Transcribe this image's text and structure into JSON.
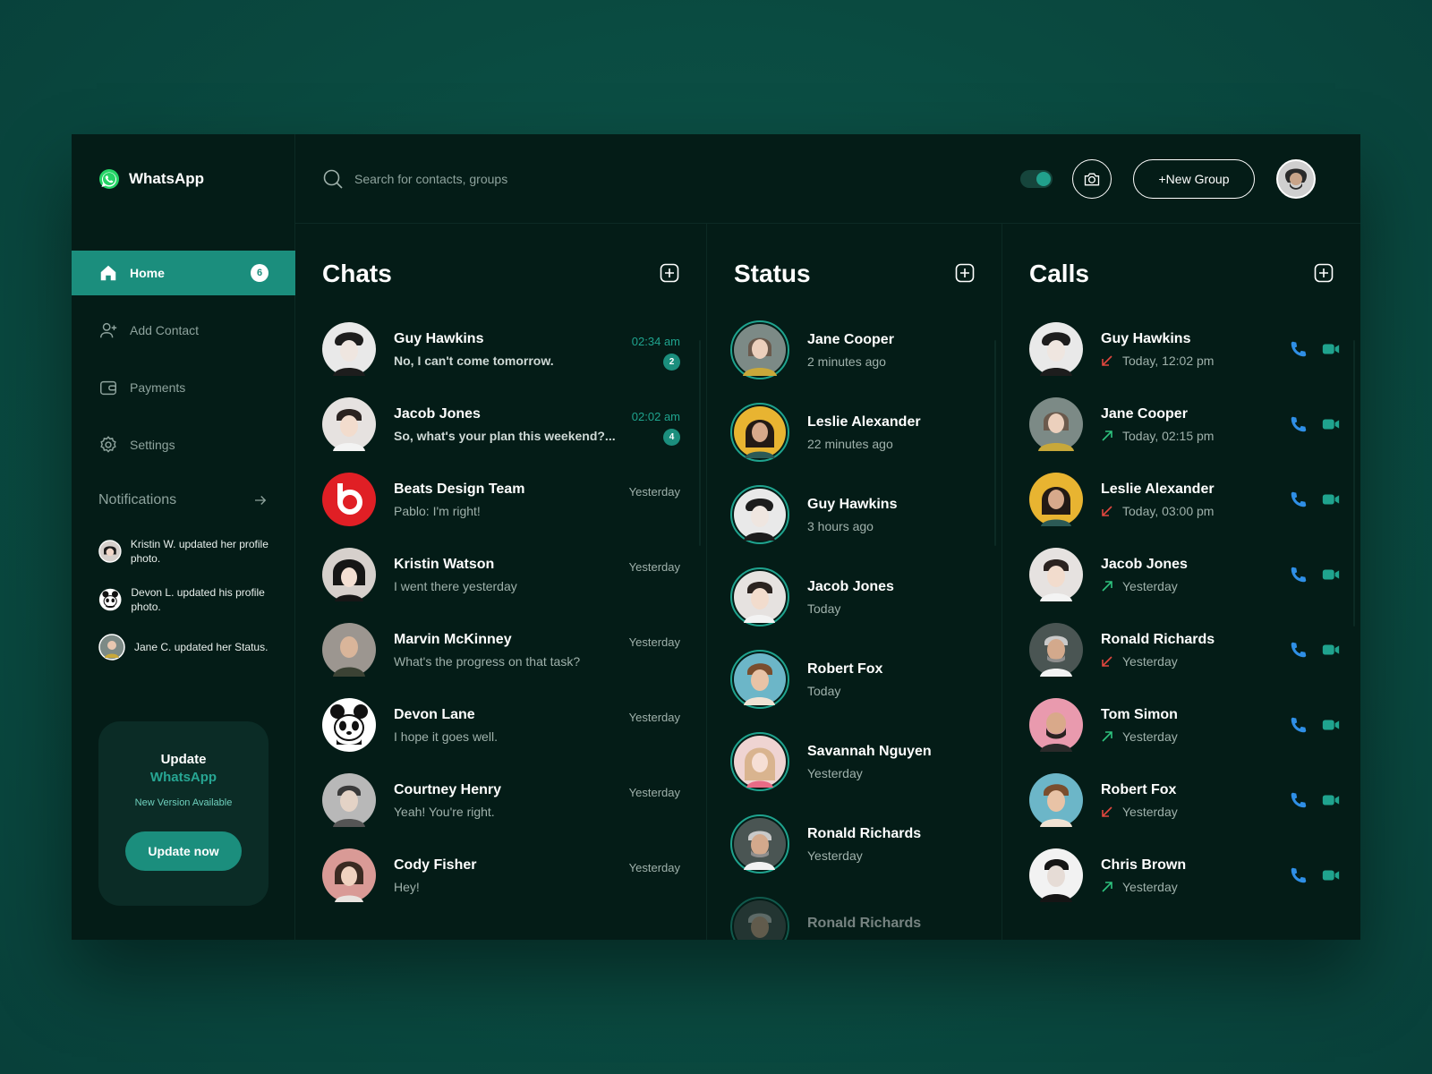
{
  "app": {
    "brand": "WhatsApp"
  },
  "nav": [
    {
      "label": "Home",
      "badge": "6",
      "icon": "home-icon",
      "active": true
    },
    {
      "label": "Add Contact",
      "icon": "add-user-icon"
    },
    {
      "label": "Payments",
      "icon": "wallet-icon"
    },
    {
      "label": "Settings",
      "icon": "gear-icon"
    }
  ],
  "notifications": {
    "title": "Notifications",
    "items": [
      {
        "text": "Kristin W. updated her profile photo.",
        "avatar": "#d6d0cc"
      },
      {
        "text": "Devon L. updated his profile photo.",
        "avatar": "#ffffff"
      },
      {
        "text": "Jane C. updated her Status.",
        "avatar": "#7c8a86"
      }
    ]
  },
  "update_card": {
    "title": "Update",
    "brand": "WhatsApp",
    "subtitle": "New Version Available",
    "button": "Update now"
  },
  "topbar": {
    "search_placeholder": "Search for contacts, groups",
    "new_group_label": "+New Group"
  },
  "chats": {
    "title": "Chats",
    "items": [
      {
        "name": "Guy Hawkins",
        "message": "No, I can't come tomorrow.",
        "time": "02:34 am",
        "unread": "2",
        "avatar": "#e9e9e9"
      },
      {
        "name": "Jacob Jones",
        "message": "So, what's your plan this weekend?...",
        "time": "02:02 am",
        "unread": "4",
        "avatar": "#e6e2e0"
      },
      {
        "name": "Beats Design Team",
        "message": "Pablo: I'm right!",
        "time": "Yesterday",
        "avatar": "#e01f25"
      },
      {
        "name": "Kristin Watson",
        "message": "I went there yesterday",
        "time": "Yesterday",
        "avatar": "#d6d0cc"
      },
      {
        "name": "Marvin McKinney",
        "message": "What's the progress on that task?",
        "time": "Yesterday",
        "avatar": "#9c9690"
      },
      {
        "name": "Devon Lane",
        "message": "I hope it goes well.",
        "time": "Yesterday",
        "avatar": "#ffffff"
      },
      {
        "name": "Courtney Henry",
        "message": "Yeah! You're right.",
        "time": "Yesterday",
        "avatar": "#b8b8b8"
      },
      {
        "name": "Cody Fisher",
        "message": "Hey!",
        "time": "Yesterday",
        "avatar": "#d99a96"
      }
    ]
  },
  "status": {
    "title": "Status",
    "items": [
      {
        "name": "Jane Cooper",
        "time": "2 minutes ago",
        "avatar": "#7c8a86"
      },
      {
        "name": "Leslie Alexander",
        "time": "22 minutes ago",
        "avatar": "#e8b431"
      },
      {
        "name": "Guy Hawkins",
        "time": "3 hours ago",
        "avatar": "#e9e9e9"
      },
      {
        "name": "Jacob Jones",
        "time": "Today",
        "avatar": "#e6e2e0"
      },
      {
        "name": "Robert Fox",
        "time": "Today",
        "avatar": "#6cb6c8"
      },
      {
        "name": "Savannah Nguyen",
        "time": "Yesterday",
        "avatar": "#efd4d2"
      },
      {
        "name": "Ronald Richards",
        "time": "Yesterday",
        "avatar": "#4a5553"
      },
      {
        "name": "Ronald Richards",
        "time": "",
        "avatar": "#4a5553"
      }
    ]
  },
  "calls": {
    "title": "Calls",
    "items": [
      {
        "name": "Guy Hawkins",
        "time": "Today, 12:02 pm",
        "direction": "missed",
        "avatar": "#e9e9e9"
      },
      {
        "name": "Jane Cooper",
        "time": "Today, 02:15 pm",
        "direction": "outgoing",
        "avatar": "#7c8a86"
      },
      {
        "name": "Leslie Alexander",
        "time": "Today, 03:00 pm",
        "direction": "missed",
        "avatar": "#e8b431"
      },
      {
        "name": "Jacob Jones",
        "time": "Yesterday",
        "direction": "outgoing",
        "avatar": "#e6e2e0"
      },
      {
        "name": "Ronald Richards",
        "time": "Yesterday",
        "direction": "missed",
        "avatar": "#4a5553"
      },
      {
        "name": "Tom Simon",
        "time": "Yesterday",
        "direction": "outgoing",
        "avatar": "#e99aae"
      },
      {
        "name": "Robert Fox",
        "time": "Yesterday",
        "direction": "missed",
        "avatar": "#6cb6c8"
      },
      {
        "name": "Chris Brown",
        "time": "Yesterday",
        "direction": "outgoing",
        "avatar": "#f2f2f2"
      }
    ]
  },
  "colors": {
    "accent": "#1b8e7d",
    "phone": "#2f8fe6",
    "video": "#1fa38e",
    "missed": "#e0463e",
    "outgoing": "#2ec27e"
  }
}
